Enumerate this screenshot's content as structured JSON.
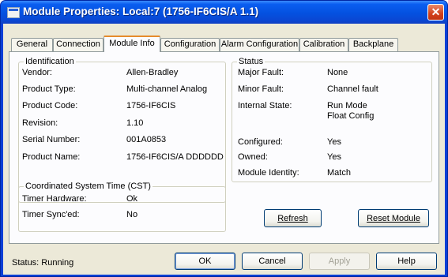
{
  "window": {
    "title": "Module Properties: Local:7 (1756-IF6CIS/A 1.1)"
  },
  "tabs": [
    {
      "label": "General"
    },
    {
      "label": "Connection"
    },
    {
      "label": "Module Info",
      "active": true
    },
    {
      "label": "Configuration"
    },
    {
      "label": "Alarm Configuration"
    },
    {
      "label": "Calibration"
    },
    {
      "label": "Backplane"
    }
  ],
  "identification": {
    "title": "Identification",
    "rows": [
      {
        "label": "Vendor:",
        "value": "Allen-Bradley"
      },
      {
        "label": "Product Type:",
        "value": "Multi-channel Analog"
      },
      {
        "label": "Product Code:",
        "value": "1756-IF6CIS"
      },
      {
        "label": "Revision:",
        "value": "1.10"
      },
      {
        "label": "Serial Number:",
        "value": "001A0853"
      },
      {
        "label": "Product Name:",
        "value": "1756-IF6CIS/A DDDDDD"
      }
    ]
  },
  "cst": {
    "title": "Coordinated System Time (CST)",
    "rows": [
      {
        "label": "Timer Hardware:",
        "value": "Ok"
      },
      {
        "label": "Timer Sync'ed:",
        "value": "No"
      }
    ]
  },
  "status_group": {
    "title": "Status",
    "rows": [
      {
        "label": "Major Fault:",
        "value": "None"
      },
      {
        "label": "Minor Fault:",
        "value": "Channel fault"
      },
      {
        "label": "Internal State:",
        "value": "Run Mode",
        "value2": "Float Config"
      },
      {
        "label": "Configured:",
        "value": "Yes"
      },
      {
        "label": "Owned:",
        "value": "Yes"
      },
      {
        "label": "Module Identity:",
        "value": "Match"
      }
    ]
  },
  "buttons": {
    "refresh": "Refresh",
    "reset_module": "Reset Module",
    "ok": "OK",
    "cancel": "Cancel",
    "apply": "Apply",
    "help": "Help"
  },
  "status_bar": {
    "text": "Status:  Running"
  }
}
